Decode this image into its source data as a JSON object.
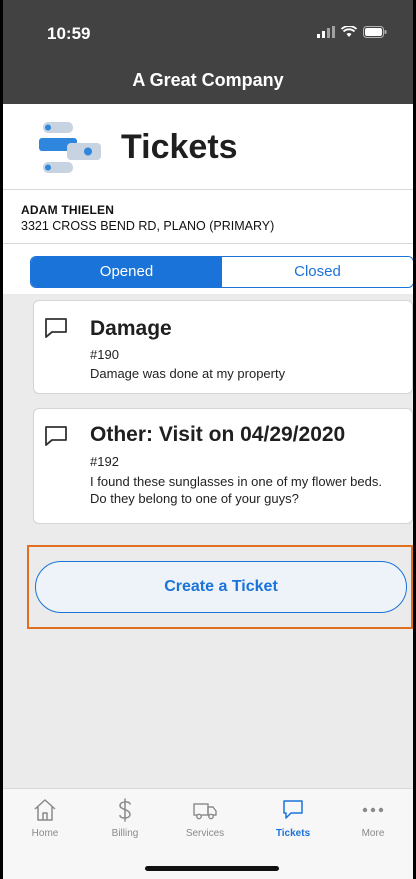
{
  "status_bar": {
    "time": "10:59"
  },
  "nav": {
    "title": "A Great Company"
  },
  "page": {
    "title": "Tickets"
  },
  "customer": {
    "name": "ADAM THIELEN",
    "address": "3321 CROSS BEND RD, PLANO (PRIMARY)"
  },
  "segments": {
    "opened": "Opened",
    "closed": "Closed",
    "selected": "Opened"
  },
  "tickets": [
    {
      "title": "Damage",
      "number": "#190",
      "description": "Damage was done at my property"
    },
    {
      "title": "Other: Visit on 04/29/2020",
      "number": "#192",
      "description": "I found these sunglasses in one of my flower beds. Do they belong to one of your guys?"
    }
  ],
  "actions": {
    "create_ticket": "Create a Ticket"
  },
  "tab_bar": {
    "items": [
      {
        "label": "Home",
        "icon": "home-icon"
      },
      {
        "label": "Billing",
        "icon": "dollar-icon"
      },
      {
        "label": "Services",
        "icon": "truck-icon"
      },
      {
        "label": "Tickets",
        "icon": "chat-bubble-icon"
      },
      {
        "label": "More",
        "icon": "more-dots-icon"
      }
    ],
    "active": "Tickets"
  },
  "colors": {
    "accent": "#1a73d9",
    "header_bg": "#424242",
    "highlight": "#e07020",
    "page_bg": "#ebebeb"
  }
}
